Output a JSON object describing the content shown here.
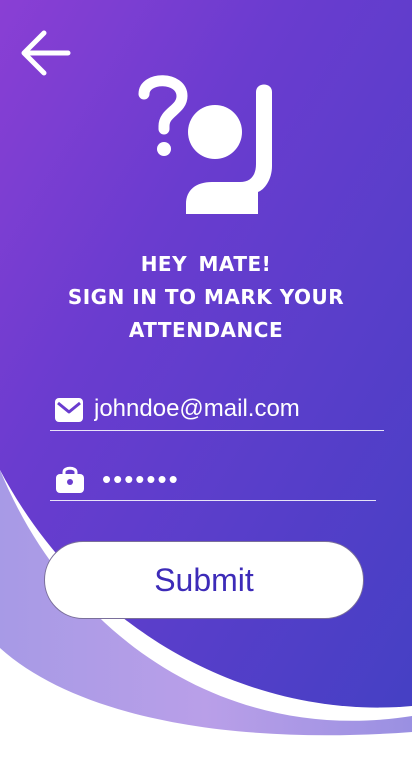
{
  "heading": {
    "line1": "HEY  MATE!",
    "line2": "SIGN IN TO MARK YOUR",
    "line3": "ATTENDANCE"
  },
  "email_field": {
    "value": "johndoe@mail.com",
    "icon": "mail-icon"
  },
  "password_field": {
    "value": "•••••••",
    "icon": "lock-icon"
  },
  "submit": {
    "label": "Submit"
  },
  "icons": {
    "back": "back-arrow-icon",
    "hero": "raised-hand-question-icon"
  },
  "colors": {
    "gradient_start": "#7e3fd6",
    "gradient_end": "#4b3fc6",
    "accent_text": "#3d2bb8",
    "lavender": "#b39ae6"
  }
}
